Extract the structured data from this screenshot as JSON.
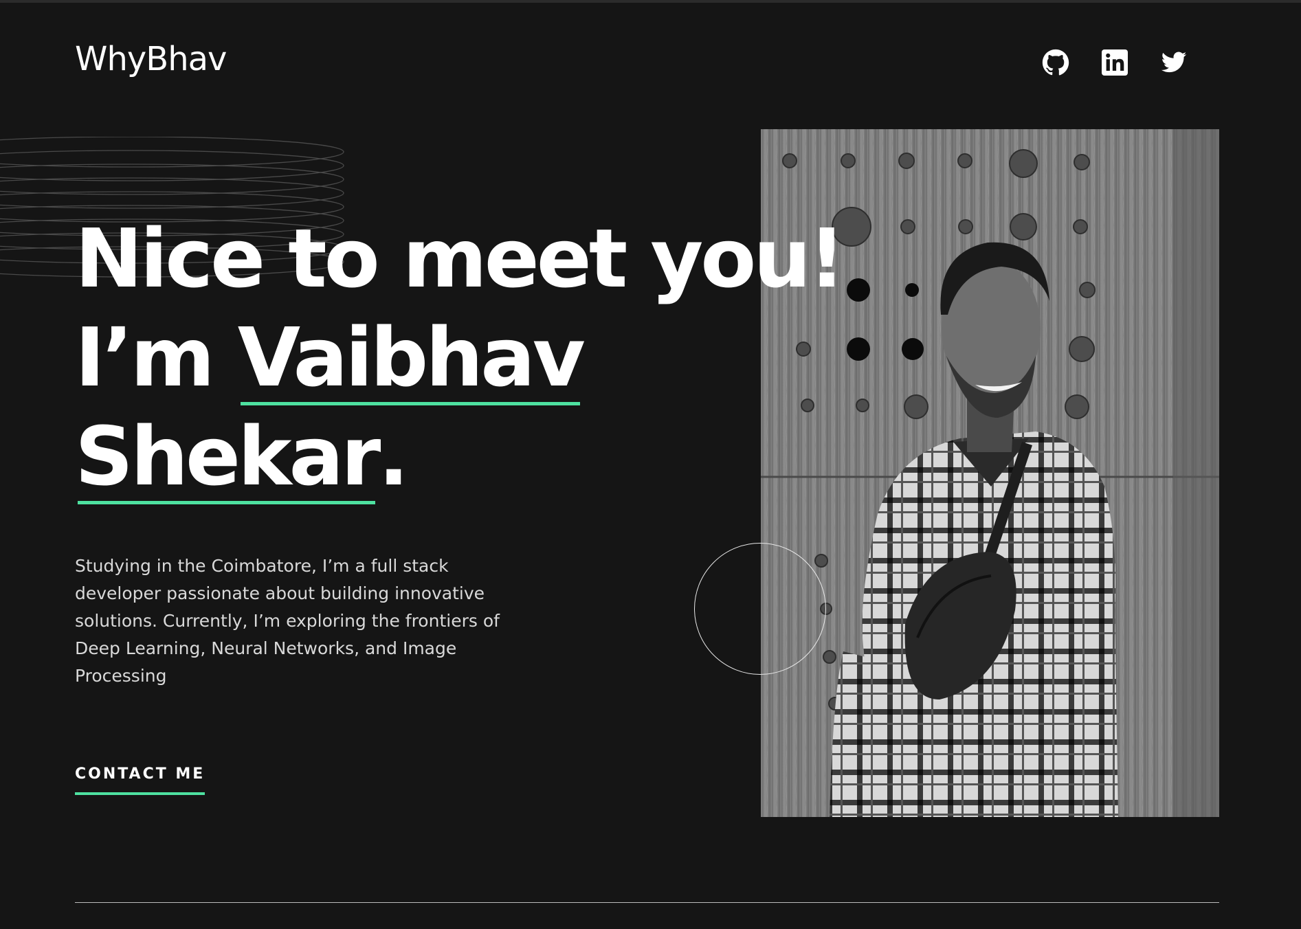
{
  "header": {
    "logo": "WhyBhav",
    "socials": [
      {
        "icon": "github-icon"
      },
      {
        "icon": "linkedin-icon"
      },
      {
        "icon": "twitter-icon"
      }
    ]
  },
  "hero": {
    "line1": "Nice to meet you!",
    "line2_prefix": "I’m ",
    "line2_name": "Vaibhav",
    "line3_name": "Shekar",
    "line3_suffix": ".",
    "description": "Studying in the Coimbatore, I’m a full stack developer passionate about building innovative solutions. Currently, I’m exploring the frontiers of Deep Learning, Neural Networks, and Image Processing",
    "cta": "CONTACT ME"
  },
  "photo": {
    "alt": "Portrait photo"
  },
  "colors": {
    "background": "#151515",
    "accent": "#4ee1a0",
    "text": "#ffffff",
    "muted_text": "#d9d9d9"
  }
}
